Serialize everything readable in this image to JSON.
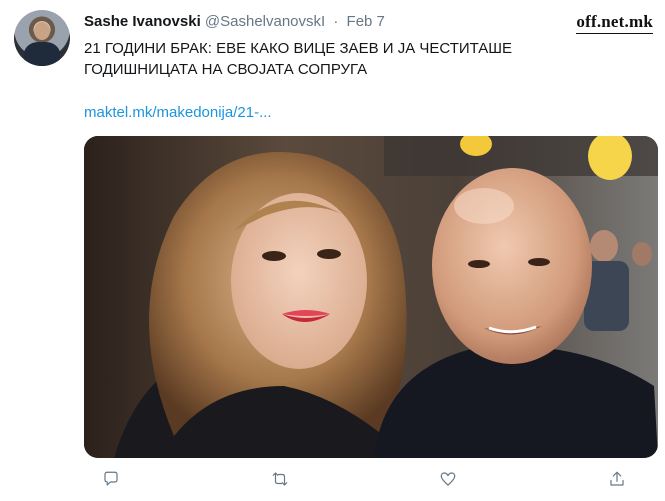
{
  "tweet": {
    "author_name": "Sashe Ivanovski",
    "author_handle": "@SashelvanovskI",
    "separator": "·",
    "date": "Feb 7",
    "text": "21 ГОДИНИ БРАК: ЕВЕ КАКО ВИЦЕ ЗАЕВ И ЈА ЧЕСТИТАШЕ ГОДИШНИЦАТА НА СВОЈАТА СОПРУГА",
    "link_text": "maktel.mk/makedonija/21-..."
  },
  "watermark": "off.net.mk",
  "actions": [
    {
      "name": "reply-icon"
    },
    {
      "name": "retweet-icon"
    },
    {
      "name": "like-icon"
    },
    {
      "name": "share-icon"
    }
  ],
  "colors": {
    "link": "#1b95e0",
    "secondary_text": "#657786",
    "icon": "#657786"
  }
}
